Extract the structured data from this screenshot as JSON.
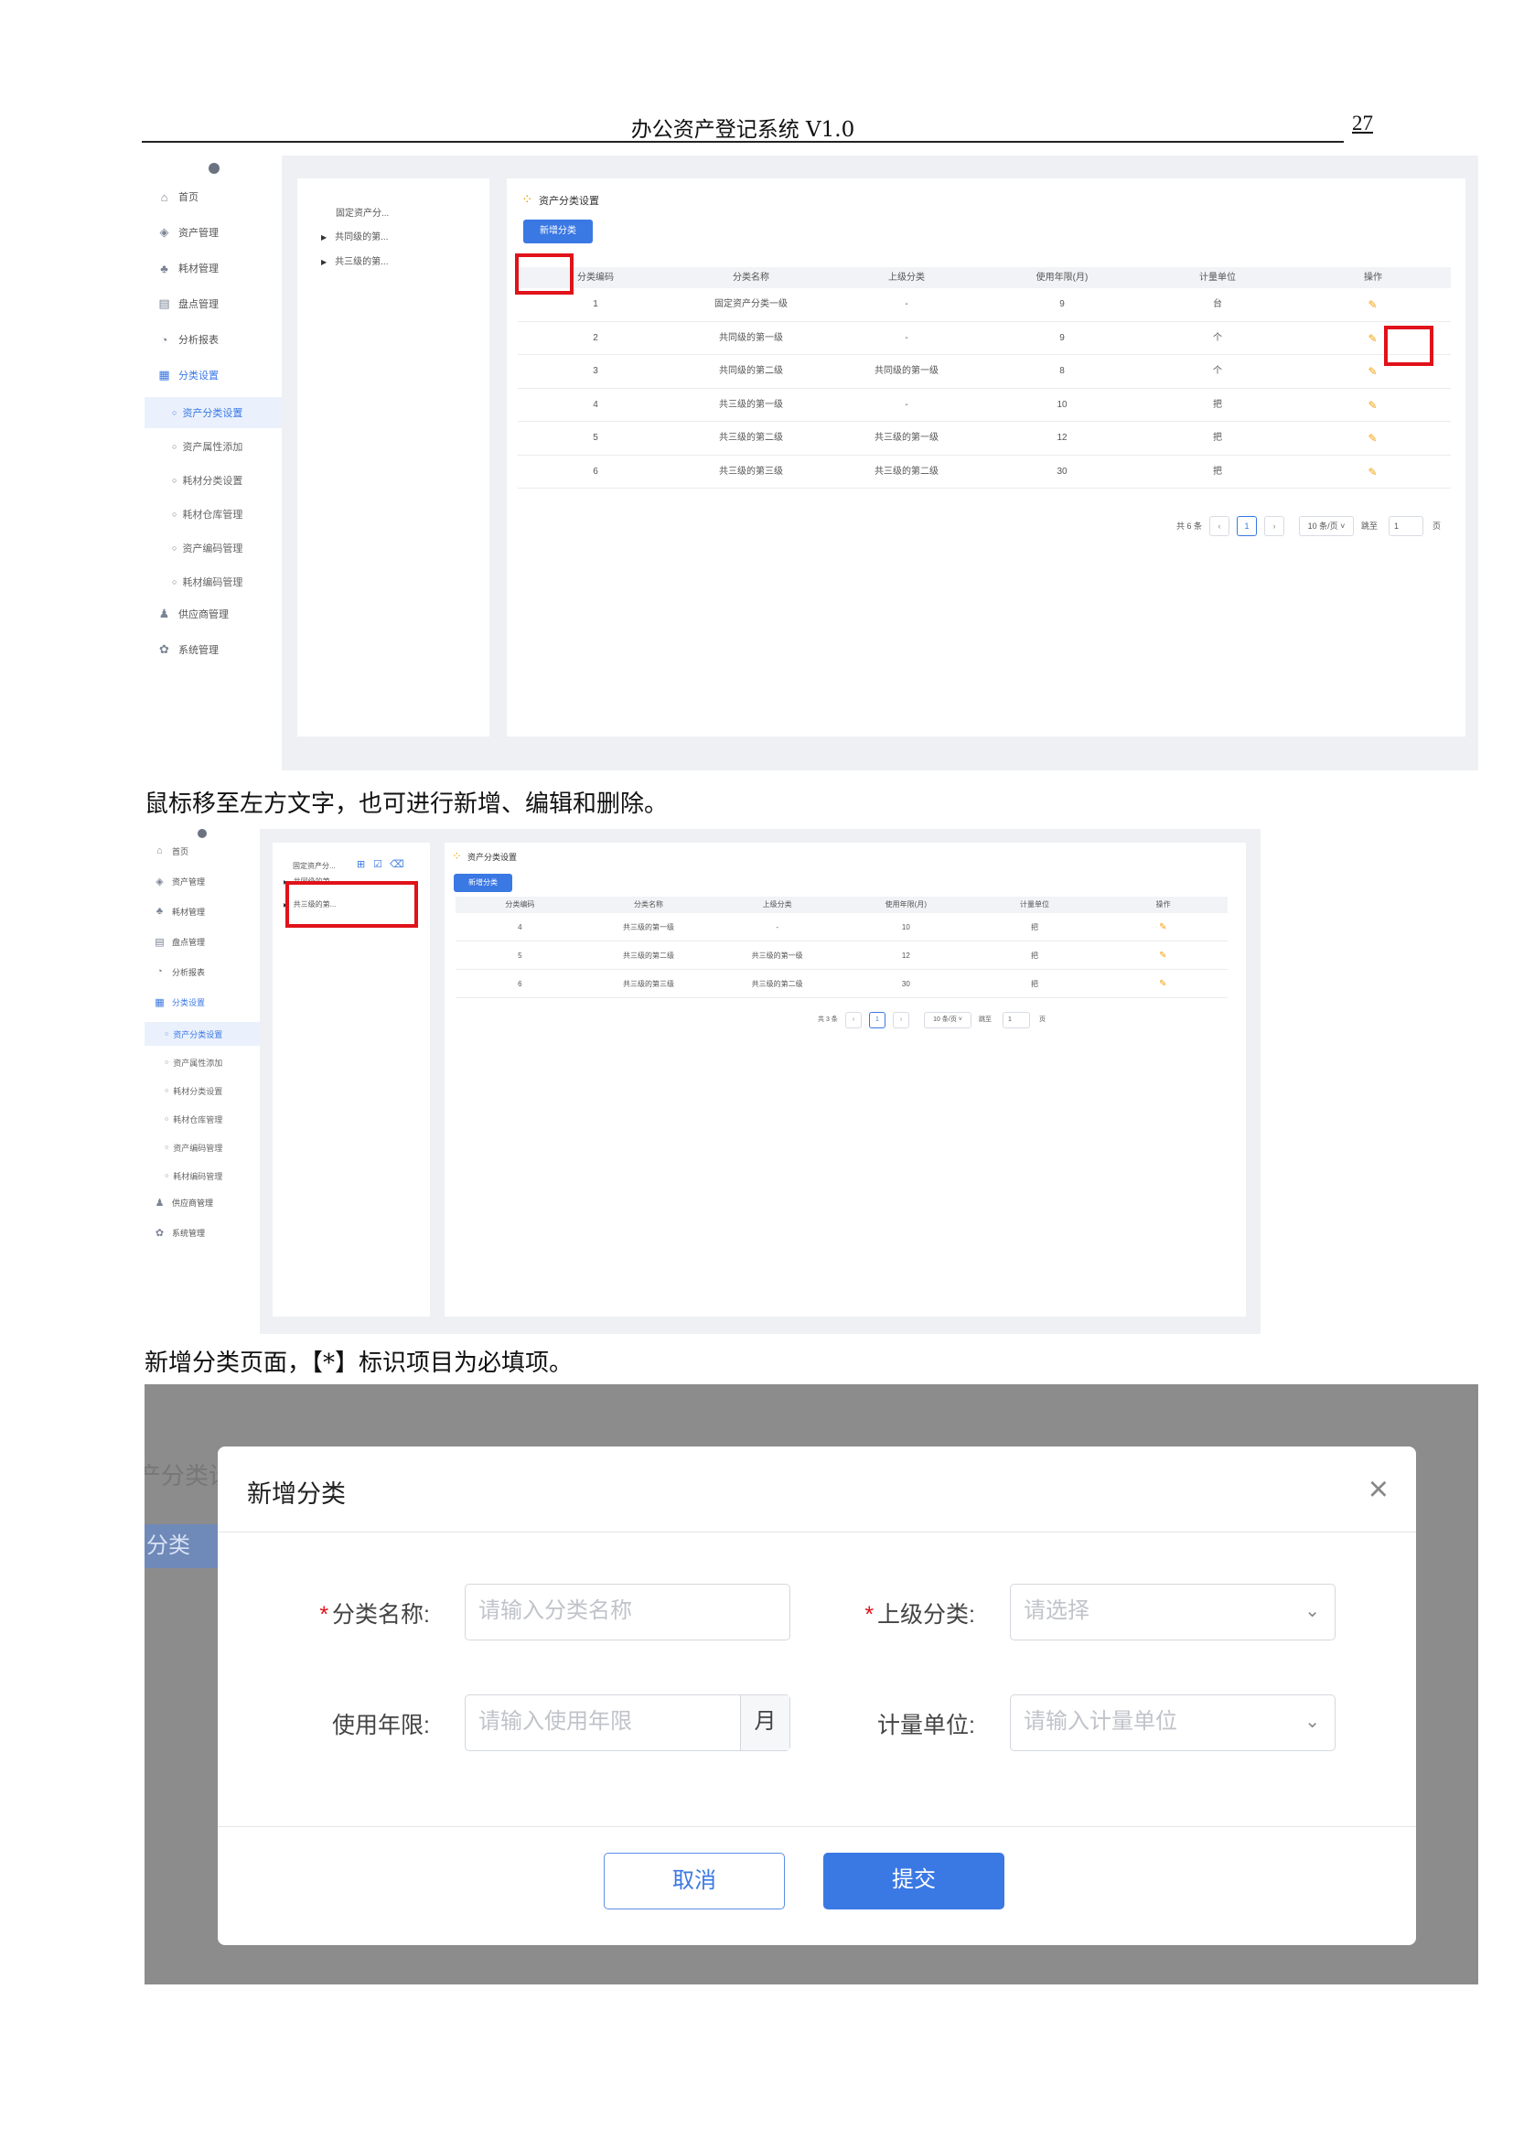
{
  "header": {
    "title": "办公资产登记系统 V1.0",
    "page_number": "27"
  },
  "captions": {
    "hover_tip": "鼠标移至左方文字，也可进行新增、编辑和删除。",
    "add_page_tip": "新增分类页面，【*】标识项目为必填项。"
  },
  "sidebar": {
    "items": [
      {
        "label": "首页",
        "icon": "home-icon",
        "glyph": "⌂"
      },
      {
        "label": "资产管理",
        "icon": "asset-icon",
        "glyph": "◈"
      },
      {
        "label": "耗材管理",
        "icon": "consumable-icon",
        "glyph": "♣"
      },
      {
        "label": "盘点管理",
        "icon": "inventory-icon",
        "glyph": "▤"
      },
      {
        "label": "分析报表",
        "icon": "chart-icon",
        "glyph": "◔"
      },
      {
        "label": "分类设置",
        "icon": "grid-icon",
        "glyph": "▦"
      }
    ],
    "subitems": [
      "资产分类设置",
      "资产属性添加",
      "耗材分类设置",
      "耗材仓库管理",
      "资产编码管理",
      "耗材编码管理"
    ],
    "tail_items": [
      {
        "label": "供应商管理",
        "icon": "supplier-icon",
        "glyph": "♟"
      },
      {
        "label": "系统管理",
        "icon": "settings-icon",
        "glyph": "✿"
      }
    ]
  },
  "tree": {
    "root": "固定资产分...",
    "children": [
      "共同级的第...",
      "共三级的第..."
    ]
  },
  "panel_title": "资产分类设置",
  "add_button": "新增分类",
  "table": {
    "headers": [
      "分类编码",
      "分类名称",
      "上级分类",
      "使用年限(月)",
      "计量单位",
      "操作"
    ],
    "rows": [
      [
        "1",
        "固定资产分类一级",
        "-",
        "9",
        "台"
      ],
      [
        "2",
        "共同级的第一级",
        "-",
        "9",
        "个"
      ],
      [
        "3",
        "共同级的第二级",
        "共同级的第一级",
        "8",
        "个"
      ],
      [
        "4",
        "共三级的第一级",
        "-",
        "10",
        "把"
      ],
      [
        "5",
        "共三级的第二级",
        "共三级的第一级",
        "12",
        "把"
      ],
      [
        "6",
        "共三级的第三级",
        "共三级的第二级",
        "30",
        "把"
      ]
    ],
    "rows_filtered": [
      [
        "4",
        "共三级的第一级",
        "-",
        "10",
        "把"
      ],
      [
        "5",
        "共三级的第二级",
        "共三级的第一级",
        "12",
        "把"
      ],
      [
        "6",
        "共三级的第三级",
        "共三级的第二级",
        "30",
        "把"
      ]
    ]
  },
  "pagination": {
    "total_1": "共 6 条",
    "total_2": "共 3 条",
    "prev": "‹",
    "next": "›",
    "page": "1",
    "page_size": "10 条/页 ˅",
    "jump_label": "跳至",
    "jump_value": "1",
    "page_suffix": "页"
  },
  "modal": {
    "behind_title": "产分类设",
    "behind_button": "分类",
    "title": "新增分类",
    "close": "×",
    "fields": {
      "name_label": "分类名称:",
      "name_placeholder": "请输入分类名称",
      "parent_label": "上级分类:",
      "parent_placeholder": "请选择",
      "life_label": "使用年限:",
      "life_placeholder": "请输入使用年限",
      "life_suffix": "月",
      "unit_label": "计量单位:",
      "unit_placeholder": "请输入计量单位"
    },
    "required_mark": "*",
    "chevron": "⌄",
    "cancel": "取消",
    "submit": "提交"
  },
  "colors": {
    "accent": "#3a78e4",
    "highlight_box": "#e0121a",
    "edit_icon": "#f2a20c",
    "overlay": "#8c8c8c"
  }
}
